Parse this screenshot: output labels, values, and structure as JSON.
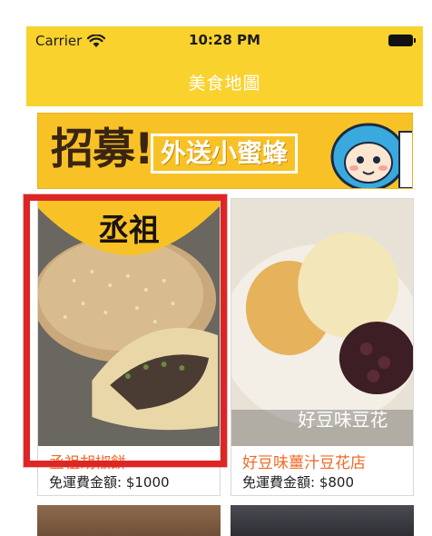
{
  "status_bar": {
    "carrier": "Carrier",
    "time": "10:28 PM",
    "wifi_icon": "wifi-icon",
    "battery_icon": "battery-icon"
  },
  "nav": {
    "title": "美食地圖"
  },
  "banner": {
    "headline": "招募!",
    "subtitle": "外送小蜜蜂"
  },
  "restaurants": [
    {
      "name": "丞祖胡椒餅",
      "fee_label": "免運費金額: $1000",
      "image_caption": "丞祖"
    },
    {
      "name": "好豆味薑汁豆花店",
      "fee_label": "免運費金額: $800",
      "image_caption": "好豆味豆花"
    }
  ],
  "colors": {
    "appbar": "#f9d22e",
    "restaurant_name": "#f26a27",
    "highlight": "#dc2626"
  }
}
